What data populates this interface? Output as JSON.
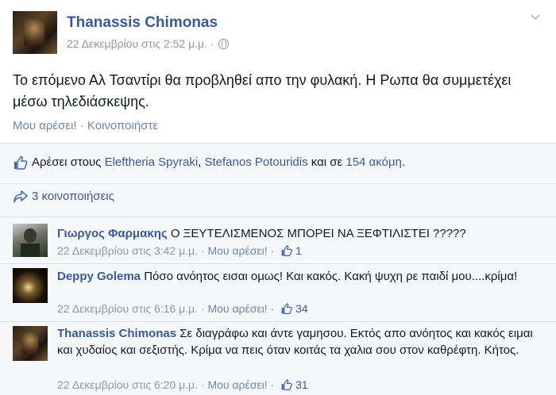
{
  "post": {
    "author": "Thanassis Chimonas",
    "timestamp": "22 Δεκεμβρίου στις 2:52 μ.μ. ·",
    "message": "Το επόμενο Αλ Τσαντίρι θα προβληθεί απο την φυλακή. Η Ρωπα θα συμμετέχει μέσω τηλεδιάσκεψης.",
    "actions": {
      "like": "Μου αρέσει!",
      "separator": "·",
      "share": "Κοινοποιήστε"
    },
    "options_icon": "chevron-down-icon"
  },
  "likes": {
    "prefix": "Αρέσει στους",
    "person1": "Eleftheria Spyraki",
    "separator": ",",
    "person2": "Stefanos Potouridis",
    "middle": "και σε",
    "others": "154 ακόμη",
    "suffix": "."
  },
  "shares": {
    "label": "3 κοινοποιήσεις"
  },
  "comments": [
    {
      "name": "Γιωργος Φαρμακης",
      "text": "Ο ΞΕΥΤΕΛΙΣΜΕΝΟΣ ΜΠΟΡΕΙ ΝΑ ΞΕΦΤΙΛΙΣΤΕΙ ?????",
      "time": "22 Δεκεμβρίου στις 3:42 μ.μ. ·",
      "like_label": "Μου αρέσει! ·",
      "likes": "1"
    },
    {
      "name": "Deppy Golema",
      "text": "Πόσο ανόητος εισαι ομως! Και κακός. Κακή ψυχη ρε παιδί μου....κρίμα!",
      "time": "22 Δεκεμβρίου στις 6:16 μ.μ. ·",
      "like_label": "Μου αρέσει! ·",
      "likes": "34"
    },
    {
      "name": "Thanassis Chimonas",
      "text": "Σε διαγράφω και άντε γαμησου. Εκτός απο ανόητος και κακός ειμαι και χυδαίος και σεξιστής. Κρίμα να πεις όταν κοιτάς τα χαλια σου στον καθρέφτη. Κήτος.",
      "time": "22 Δεκεμβρίου στις 6:20 μ.μ. ·",
      "like_label": "Μου αρέσει! ·",
      "likes": "31"
    }
  ],
  "colors": {
    "link": "#3b5998",
    "meta": "#9197a3",
    "ufi_bg": "#f6f7f8"
  }
}
